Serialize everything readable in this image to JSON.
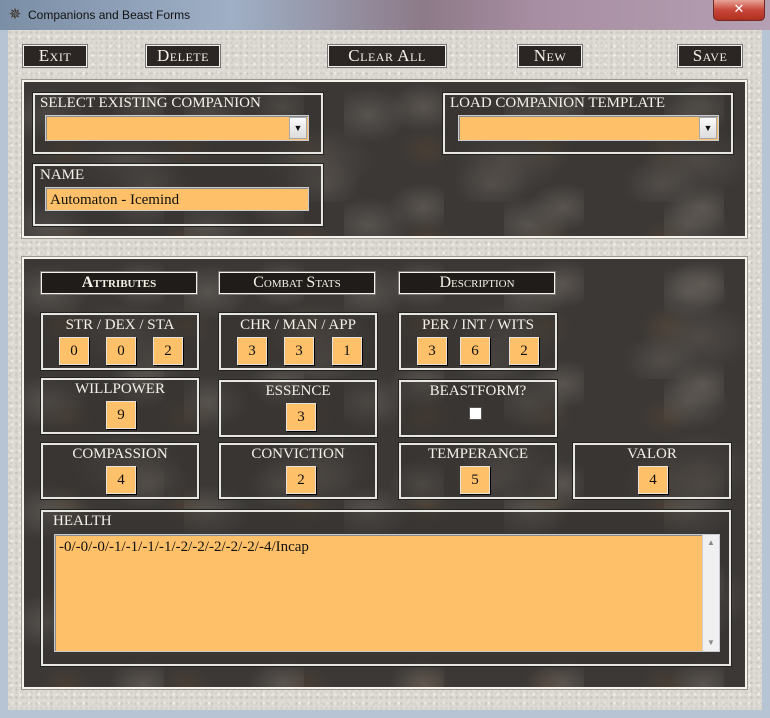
{
  "window": {
    "title": "Companions and Beast Forms",
    "close_label": "✕"
  },
  "toolbar": {
    "exit": "Exit",
    "delete": "Delete",
    "clear_all": "Clear All",
    "new": "New",
    "save": "Save"
  },
  "header": {
    "select_companion": {
      "label": "SELECT EXISTING COMPANION",
      "value": ""
    },
    "load_template": {
      "label": "LOAD COMPANION TEMPLATE",
      "value": ""
    },
    "name": {
      "label": "NAME",
      "value": "Automaton - Icemind"
    }
  },
  "tabs": {
    "attributes": "Attributes",
    "combat_stats": "Combat Stats",
    "description": "Description"
  },
  "stats": {
    "physical": {
      "label": "STR / DEX / STA",
      "values": [
        "0",
        "0",
        "2"
      ]
    },
    "social": {
      "label": "CHR / MAN / APP",
      "values": [
        "3",
        "3",
        "1"
      ]
    },
    "mental": {
      "label": "PER / INT / WITS",
      "values": [
        "3",
        "6",
        "2"
      ]
    },
    "willpower": {
      "label": "WILLPOWER",
      "value": "9"
    },
    "essence": {
      "label": "ESSENCE",
      "value": "3"
    },
    "beastform": {
      "label": "BEASTFORM?",
      "checked": false
    },
    "compassion": {
      "label": "COMPASSION",
      "value": "4"
    },
    "conviction": {
      "label": "CONVICTION",
      "value": "2"
    },
    "temperance": {
      "label": "TEMPERANCE",
      "value": "5"
    },
    "valor": {
      "label": "VALOR",
      "value": "4"
    }
  },
  "health": {
    "label": "HEALTH",
    "value": "-0/-0/-0/-1/-1/-1/-1/-2/-2/-2/-2/-2/-4/Incap"
  },
  "icons": {
    "app": "skull-gear-icon",
    "dropdown": "chevron-down-icon",
    "scroll_up": "triangle-up-icon",
    "scroll_down": "triangle-down-icon"
  },
  "colors": {
    "field": "#fec069",
    "panel": "#3b3836"
  }
}
